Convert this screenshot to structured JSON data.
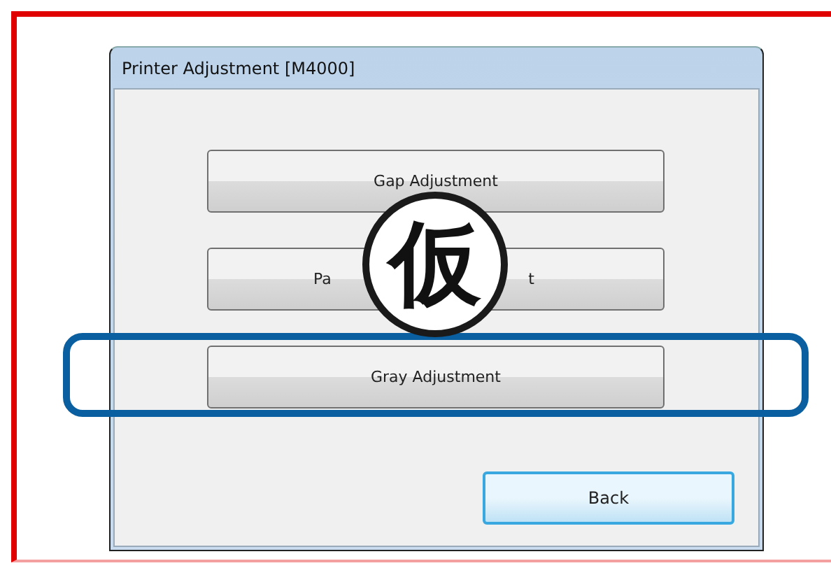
{
  "window": {
    "title": "Printer Adjustment [M4000]"
  },
  "buttons": [
    {
      "label_parts": [
        "Gap Adjustment"
      ],
      "highlighted": false
    },
    {
      "label_parts": [
        "Pa",
        "t"
      ],
      "highlighted": false
    },
    {
      "label_parts": [
        "Gray Adjustment"
      ],
      "highlighted": true
    }
  ],
  "back_button": "Back",
  "stamp": "仮"
}
